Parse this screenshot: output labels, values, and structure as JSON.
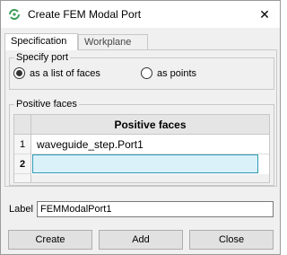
{
  "window": {
    "title": "Create FEM Modal Port",
    "close_glyph": "✕",
    "app_icon": "fem-app-icon",
    "accent_color": "#2e9ab3"
  },
  "tabs": [
    {
      "label": "Specification",
      "active": true
    },
    {
      "label": "Workplane",
      "active": false
    }
  ],
  "specify_port": {
    "title": "Specify port",
    "options": [
      {
        "label": "as a list of faces",
        "selected": true
      },
      {
        "label": "as points",
        "selected": false
      }
    ]
  },
  "positive_faces": {
    "title": "Positive faces",
    "column_header": "Positive faces",
    "rows": [
      {
        "index": "1",
        "value": "waveguide_step.Port1"
      },
      {
        "index": "2",
        "value": ""
      }
    ]
  },
  "label_field": {
    "label": "Label",
    "value": "FEMModalPort1"
  },
  "buttons": {
    "create": "Create",
    "add": "Add",
    "close": "Close"
  }
}
